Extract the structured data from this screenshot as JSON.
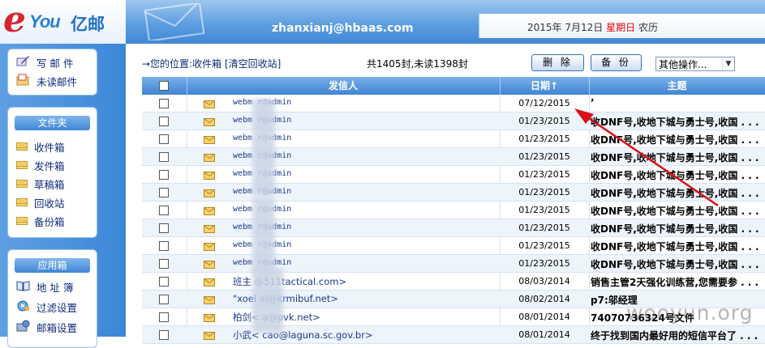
{
  "logo": {
    "e": "e",
    "you": "You",
    "cn": "亿邮"
  },
  "header": {
    "email": "zhanxianj@hbaas.com",
    "date_prefix": "2015年  7月12日",
    "weekday": "星期日",
    "calendar": "农历"
  },
  "sidebar": {
    "top_items": [
      {
        "label": "写 邮 件",
        "icon": "write-mail-icon"
      },
      {
        "label": "未读邮件",
        "icon": "unread-mail-icon"
      }
    ],
    "folders_title": "文件夹",
    "folders": [
      {
        "label": "收件箱"
      },
      {
        "label": "发件箱"
      },
      {
        "label": "草稿箱"
      },
      {
        "label": "回收站"
      },
      {
        "label": "备份箱"
      }
    ],
    "apps_title": "应用箱",
    "apps": [
      {
        "label": "地 址 簿",
        "icon": "address-book-icon"
      },
      {
        "label": "过滤设置",
        "icon": "filter-settings-icon"
      },
      {
        "label": "邮箱设置",
        "icon": "mailbox-settings-icon"
      }
    ]
  },
  "location": {
    "prefix": "→您的位置:",
    "folder": "收件箱",
    "action": "[清空回收站]"
  },
  "count_text": "共1405封,未读1398封",
  "toolbar": {
    "delete_label": "删 除",
    "backup_label": "备 份",
    "other_ops": "其他操作..."
  },
  "table": {
    "headers": {
      "sender": "发信人",
      "date": "日期↑",
      "subject": "主题"
    },
    "rows": [
      {
        "sender": "webm        r@admin",
        "date": "07/12/2015",
        "subject": "’"
      },
      {
        "sender": "webm        r@admin",
        "date": "01/23/2015",
        "subject": "收DNF号,收地下城与勇士号,收国 . . ."
      },
      {
        "sender": "webm        r@admin",
        "date": "01/23/2015",
        "subject": "收DNF号,收地下城与勇士号,收国 . . ."
      },
      {
        "sender": "webm        r@admin",
        "date": "01/23/2015",
        "subject": "收DNF号,收地下城与勇士号,收国 . . ."
      },
      {
        "sender": "webm        r@admin",
        "date": "01/23/2015",
        "subject": "收DNF号,收地下城与勇士号,收国 . . ."
      },
      {
        "sender": "webm        r@admin",
        "date": "01/23/2015",
        "subject": "收DNF号,收地下城与勇士号,收国 . . ."
      },
      {
        "sender": "webm        r@admin",
        "date": "01/23/2015",
        "subject": "收DNF号,收地下城与勇士号,收国 . . ."
      },
      {
        "sender": "webm        r@admin",
        "date": "01/23/2015",
        "subject": "收DNF号,收地下城与勇士号,收国 . . ."
      },
      {
        "sender": "webm        r@admin",
        "date": "01/23/2015",
        "subject": "收DNF号,收地下城与勇士号,收国 . . ."
      },
      {
        "sender": "webm        r@admin",
        "date": "01/23/2015",
        "subject": "收DNF号,收地下城与勇士号,收国 . . ."
      },
      {
        "sender": "班主     @511tactical.com>",
        "date": "08/03/2014",
        "subject": "销售主管2天强化训练营,您需要参 . . .",
        "cn": true
      },
      {
        "sender": "\"xoel     al@krmibuf.net>",
        "date": "08/02/2014",
        "subject": "p7:邬经理",
        "cn": true
      },
      {
        "sender": "柏剑<      a@pvk.net>",
        "date": "08/01/2014",
        "subject": "74070736324号文件",
        "cn": true
      },
      {
        "sender": "小武<      cao@laguna.sc.gov.br>",
        "date": "08/01/2014",
        "subject": "终于找到国内最好用的短信平台了 . . .",
        "cn": true
      }
    ]
  },
  "watermark": "wooyun.org",
  "colors": {
    "header_blue": "#3f88d7",
    "weekday_red": "#e00000",
    "annotation_red": "#d9111a"
  }
}
